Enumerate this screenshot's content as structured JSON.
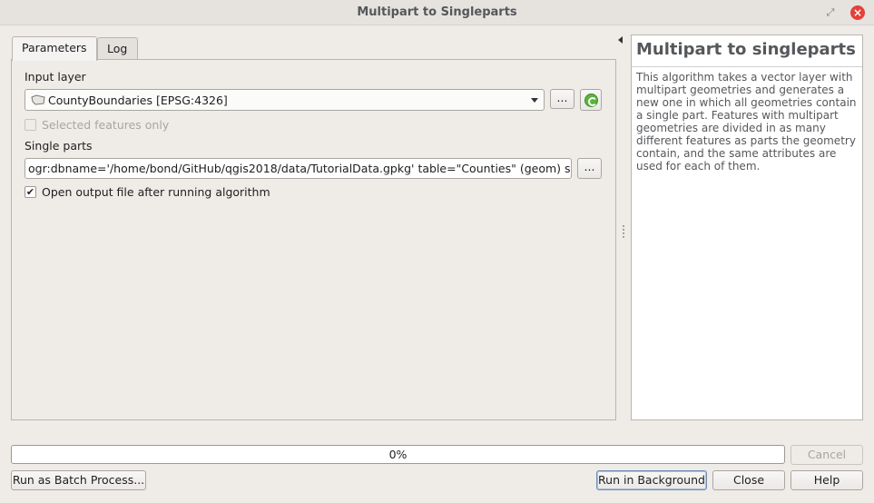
{
  "window": {
    "title": "Multipart to Singleparts"
  },
  "tabs": [
    {
      "label": "Parameters"
    },
    {
      "label": "Log"
    }
  ],
  "params": {
    "input_layer_label": "Input layer",
    "input_layer_value": "CountyBoundaries [EPSG:4326]",
    "browse_label": "...",
    "selected_only_label": "Selected features only",
    "single_parts_label": "Single parts",
    "single_parts_value": "ogr:dbname='/home/bond/GitHub/qgis2018/data/TutorialData.gpkg' table=\"Counties\" (geom) sql=",
    "open_output_label": "Open output file after running algorithm",
    "open_output_checked": true,
    "selected_only_checked": false
  },
  "help": {
    "title": "Multipart to singleparts",
    "body": "This algorithm takes a vector layer with multipart geometries and generates a new one in which all geometries contain a single part. Features with multipart geometries are divided in as many different features as parts the geometry contain, and the same attributes are used for each of them."
  },
  "footer": {
    "progress_text": "0%",
    "progress_value": 0,
    "cancel_label": "Cancel",
    "batch_label": "Run as Batch Process...",
    "run_background_label": "Run in Background",
    "close_label": "Close",
    "help_label": "Help"
  },
  "icons": {
    "check_glyph": "✔",
    "restore_glyph": "⤢",
    "close_glyph": "×"
  }
}
